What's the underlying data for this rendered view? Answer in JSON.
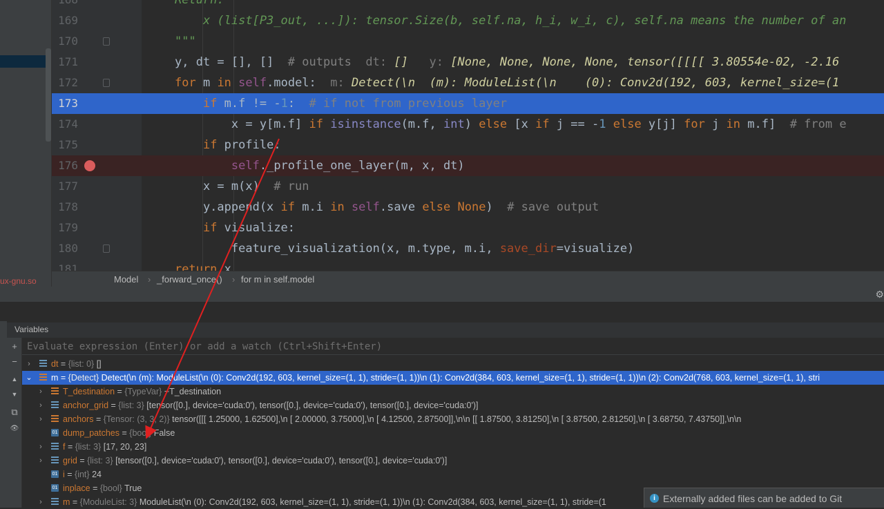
{
  "left_panel": {
    "file_label": "ux-gnu.so"
  },
  "editor": {
    "lines": [
      {
        "n": "168",
        "html": "<span class=\"doc\">Return:</span>"
      },
      {
        "n": "169",
        "html": "<span class=\"doc\">    x (list[P3_out, ...]): tensor.Size(b, self.na, h_i, w_i, c), self.na means the number of an</span>"
      },
      {
        "n": "170",
        "html": "<span class=\"doc\">\"\"\"</span>"
      },
      {
        "n": "171",
        "html": "y, dt = [], []  <span class=\"cm\"># outputs</span>  <span class=\"hint\">dt:</span> <span class=\"hintv\">[]</span>   <span class=\"hint\">y:</span> <span class=\"hintv\">[None, None, None, None, tensor([[[[ 3.80554e-02, -2.16</span>"
      },
      {
        "n": "172",
        "html": "<span class=\"kw\">for</span> m <span class=\"kw\">in</span> <span class=\"self\">self</span>.model:  <span class=\"hint\">m:</span> <span class=\"hintv\">Detect(\\n  (m): ModuleList(\\n    (0): Conv2d(192, 603, kernel_size=(1</span>"
      },
      {
        "n": "173",
        "html": "    <span class=\"kw\">if</span> m.f != -<span class=\"num\">1</span>:  <span class=\"cm\"># if not from previous layer</span>"
      },
      {
        "n": "174",
        "html": "        x = y[m.f] <span class=\"kw\">if</span> <span class=\"bi\">isinstance</span>(m.f, <span class=\"bi\">int</span>) <span class=\"kw\">else</span> [x <span class=\"kw\">if</span> j == -<span class=\"num\">1</span> <span class=\"kw\">else</span> y[j] <span class=\"kw\">for</span> j <span class=\"kw\">in</span> m.f]  <span class=\"cm\"># from e</span>"
      },
      {
        "n": "175",
        "html": "    <span class=\"kw\">if</span> profile:"
      },
      {
        "n": "176",
        "html": "        <span class=\"self\">self</span>._profile_one_layer(m, x, dt)"
      },
      {
        "n": "177",
        "html": "    x = m(x)  <span class=\"cm\"># run</span>"
      },
      {
        "n": "178",
        "html": "    y.append(x <span class=\"kw\">if</span> m.i <span class=\"kw\">in</span> <span class=\"self\">self</span>.save <span class=\"kw\">else</span> <span class=\"kw\">None</span>)  <span class=\"cm\"># save output</span>"
      },
      {
        "n": "179",
        "html": "    <span class=\"kw\">if</span> visualize:"
      },
      {
        "n": "180",
        "html": "        feature_visualization(x, m.type, m.i, <span class=\"param\">save_dir</span>=visualize)"
      },
      {
        "n": "181",
        "html": "<span class=\"kw\">return</span> x"
      }
    ]
  },
  "breadcrumb": {
    "items": [
      "Model",
      "_forward_once()",
      "for m in self.model"
    ],
    "sep": "›"
  },
  "debug": {
    "variables_title": "Variables",
    "eval_placeholder": "Evaluate expression (Enter) or add a watch (Ctrl+Shift+Enter)",
    "tools": [
      "+",
      "−",
      "▲",
      "▼",
      "⧉",
      "👁"
    ]
  },
  "variables": [
    {
      "indent": 0,
      "expand": "›",
      "icon": "list",
      "name": "dt",
      "type": "{list: 0}",
      "value": "[]"
    },
    {
      "indent": 0,
      "expand": "⌄",
      "icon": "obj",
      "name": "m",
      "type": "{Detect}",
      "value": "Detect(\\n  (m): ModuleList(\\n    (0): Conv2d(192, 603, kernel_size=(1, 1), stride=(1, 1))\\n    (1): Conv2d(384, 603, kernel_size=(1, 1), stride=(1, 1))\\n    (2): Conv2d(768, 603, kernel_size=(1, 1), stri",
      "selected": true
    },
    {
      "indent": 1,
      "expand": "›",
      "icon": "obj",
      "name": "T_destination",
      "type": "{TypeVar}",
      "value": "~T_destination"
    },
    {
      "indent": 1,
      "expand": "›",
      "icon": "list",
      "name": "anchor_grid",
      "type": "{list: 3}",
      "value": "[tensor([0.], device='cuda:0'), tensor([0.], device='cuda:0'), tensor([0.], device='cuda:0')]"
    },
    {
      "indent": 1,
      "expand": "›",
      "icon": "obj",
      "name": "anchors",
      "type": "{Tensor: (3, 3, 2)}",
      "value": "tensor([[[ 1.25000,  1.62500],\\n        [ 2.00000,  3.75000],\\n        [ 4.12500,  2.87500]],\\n\\n       [[ 1.87500,  3.81250],\\n        [ 3.87500,  2.81250],\\n        [ 3.68750,  7.43750]],\\n\\n"
    },
    {
      "indent": 1,
      "expand": "",
      "icon": "prim",
      "name": "dump_patches",
      "type": "{bool}",
      "value": "False"
    },
    {
      "indent": 1,
      "expand": "›",
      "icon": "list",
      "name": "f",
      "type": "{list: 3}",
      "value": "[17, 20, 23]"
    },
    {
      "indent": 1,
      "expand": "›",
      "icon": "list",
      "name": "grid",
      "type": "{list: 3}",
      "value": "[tensor([0.], device='cuda:0'), tensor([0.], device='cuda:0'), tensor([0.], device='cuda:0')]"
    },
    {
      "indent": 1,
      "expand": "",
      "icon": "prim",
      "name": "i",
      "type": "{int}",
      "value": "24"
    },
    {
      "indent": 1,
      "expand": "",
      "icon": "prim",
      "name": "inplace",
      "type": "{bool}",
      "value": "True"
    },
    {
      "indent": 1,
      "expand": "›",
      "icon": "list",
      "name": "m",
      "type": "{ModuleList: 3}",
      "value": "ModuleList(\\n  (0): Conv2d(192, 603, kernel_size=(1, 1), stride=(1, 1))\\n  (1): Conv2d(384, 603, kernel_size=(1, 1), stride=(1"
    }
  ],
  "notification": {
    "text": "Externally added files can be added to Git",
    "icon": "info-icon"
  },
  "colors": {
    "accent": "#2f65ca",
    "breakpoint": "#db5c5c",
    "annotation": "#e02020"
  }
}
